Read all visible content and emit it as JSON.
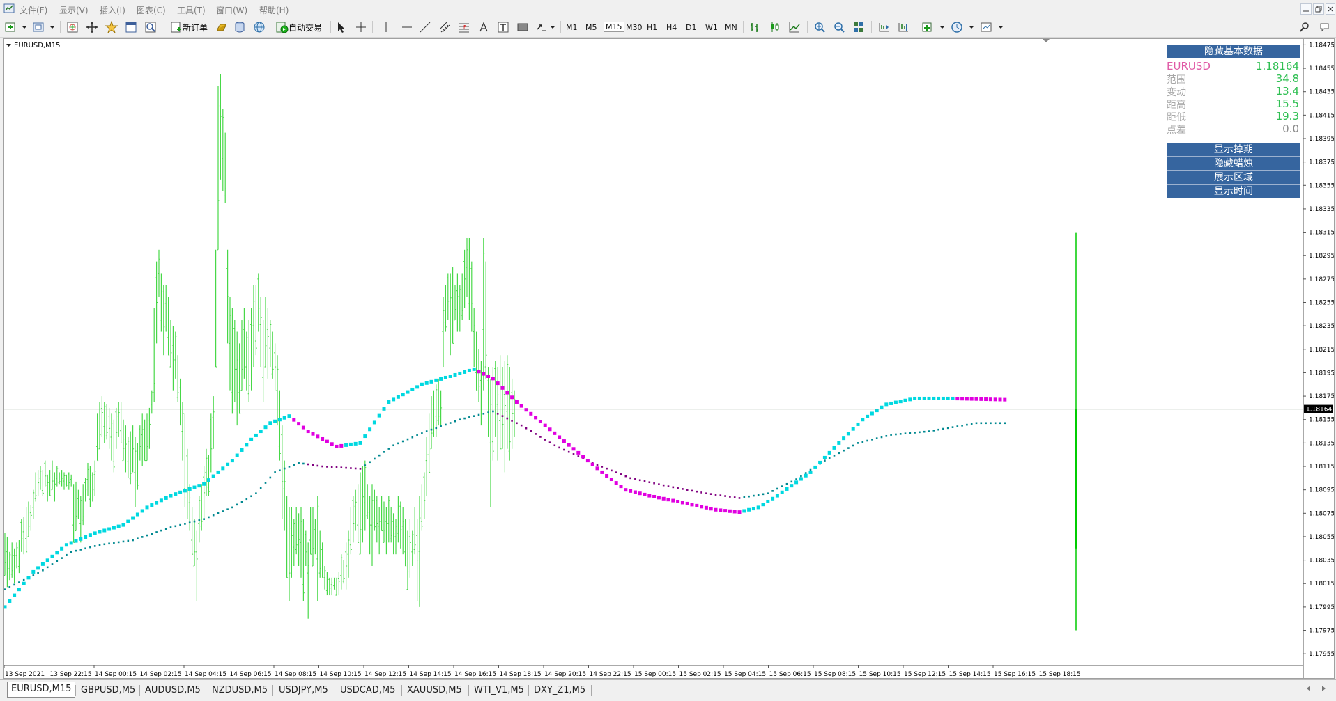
{
  "menu": {
    "items": [
      "文件(F)",
      "显示(V)",
      "插入(I)",
      "图表(C)",
      "工具(T)",
      "窗口(W)",
      "帮助(H)"
    ]
  },
  "toolbar": {
    "new_order_label": "新订单",
    "auto_trade_label": "自动交易",
    "timeframes": [
      "M1",
      "M5",
      "M15",
      "M30",
      "H1",
      "H4",
      "D1",
      "W1",
      "MN"
    ]
  },
  "chart": {
    "title": "EURUSD,M15",
    "current_price_label": "1.18164",
    "colors": {
      "bar": "#48d848",
      "last_bar": "#00cc00",
      "ma_up": "#00d8e0",
      "ma_down": "#e000e0",
      "ma2_up": "#008890",
      "ma2_down": "#800080"
    },
    "y_axis": {
      "min": 1.17945,
      "max": 1.1848
    },
    "y_ticks": [
      "1.18475",
      "1.18455",
      "1.18435",
      "1.18415",
      "1.18395",
      "1.18375",
      "1.18355",
      "1.18335",
      "1.18315",
      "1.18295",
      "1.18275",
      "1.18255",
      "1.18235",
      "1.18215",
      "1.18195",
      "1.18175",
      "1.18155",
      "1.18135",
      "1.18115",
      "1.18095",
      "1.18075",
      "1.18055",
      "1.18035",
      "1.18015",
      "1.17995",
      "1.17975",
      "1.17955"
    ],
    "x_ticks": [
      "13 Sep 2021",
      "13 Sep 22:15",
      "14 Sep 00:15",
      "14 Sep 02:15",
      "14 Sep 04:15",
      "14 Sep 06:15",
      "14 Sep 08:15",
      "14 Sep 10:15",
      "14 Sep 12:15",
      "14 Sep 14:15",
      "14 Sep 16:15",
      "14 Sep 18:15",
      "14 Sep 20:15",
      "14 Sep 22:15",
      "15 Sep 00:15",
      "15 Sep 02:15",
      "15 Sep 04:15",
      "15 Sep 06:15",
      "15 Sep 08:15",
      "15 Sep 10:15",
      "15 Sep 12:15",
      "15 Sep 14:15",
      "15 Sep 16:15",
      "15 Sep 18:15"
    ]
  },
  "info_panel": {
    "hide_basic_data": "隐藏基本数据",
    "symbol": "EURUSD",
    "price": "1.18164",
    "rows": [
      {
        "label": "范围",
        "value": "34.8"
      },
      {
        "label": "变动",
        "value": "13.4"
      },
      {
        "label": "距高",
        "value": "15.5"
      },
      {
        "label": "距低",
        "value": "19.3"
      },
      {
        "label": "点差",
        "value": "0.0"
      }
    ],
    "buttons": [
      "显示掉期",
      "隐藏蜡烛",
      "展示区域",
      "显示时间"
    ]
  },
  "tabs": [
    "EURUSD,M15",
    "GBPUSD,M5",
    "AUDUSD,M5",
    "NZDUSD,M5",
    "USDJPY,M5",
    "USDCAD,M5",
    "XAUUSD,M5",
    "WTI_V1,M5",
    "DXY_Z1,M5"
  ],
  "chart_data": {
    "type": "ohlc",
    "symbol": "EURUSD",
    "timeframe": "M15",
    "current_price": 1.18164,
    "ylim": [
      1.17945,
      1.1848
    ],
    "last_bar": {
      "high": 1.18315,
      "low": 1.17975,
      "open": 1.18164,
      "close": 1.18045
    },
    "ranges": [
      [
        1.18058,
        1.18022
      ],
      [
        1.18055,
        1.18012
      ],
      [
        1.18042,
        1.18018
      ],
      [
        1.1805,
        1.1802
      ],
      [
        1.18045,
        1.18015
      ],
      [
        1.1805,
        1.18028
      ],
      [
        1.18052,
        1.18024
      ],
      [
        1.1807,
        1.18042
      ],
      [
        1.18072,
        1.1804
      ],
      [
        1.1808,
        1.18042
      ],
      [
        1.18085,
        1.18055
      ],
      [
        1.18082,
        1.1806
      ],
      [
        1.18095,
        1.1807
      ],
      [
        1.1811,
        1.18085
      ],
      [
        1.18112,
        1.1809
      ],
      [
        1.18115,
        1.18095
      ],
      [
        1.18112,
        1.1809
      ],
      [
        1.1812,
        1.18098
      ],
      [
        1.18108,
        1.18085
      ],
      [
        1.18112,
        1.1809
      ],
      [
        1.1812,
        1.18095
      ],
      [
        1.1811,
        1.18085
      ],
      [
        1.18115,
        1.18098
      ],
      [
        1.1811,
        1.181
      ],
      [
        1.18112,
        1.18098
      ],
      [
        1.1811,
        1.18095
      ],
      [
        1.18108,
        1.18098
      ],
      [
        1.1811,
        1.18095
      ],
      [
        1.18108,
        1.18098
      ],
      [
        1.181,
        1.1805
      ],
      [
        1.18102,
        1.1806
      ],
      [
        1.18095,
        1.1807
      ],
      [
        1.1809,
        1.1805
      ],
      [
        1.181,
        1.18065
      ],
      [
        1.18105,
        1.18085
      ],
      [
        1.18118,
        1.1809
      ],
      [
        1.18115,
        1.1808
      ],
      [
        1.1811,
        1.18085
      ],
      [
        1.1812,
        1.1809
      ],
      [
        1.1816,
        1.1812
      ],
      [
        1.1817,
        1.1813
      ],
      [
        1.18175,
        1.1814
      ],
      [
        1.1817,
        1.18135
      ],
      [
        1.18168,
        1.18138
      ],
      [
        1.18165,
        1.1813
      ],
      [
        1.1816,
        1.1812
      ],
      [
        1.18155,
        1.1811
      ],
      [
        1.18165,
        1.1813
      ],
      [
        1.1817,
        1.1814
      ],
      [
        1.1817,
        1.18135
      ],
      [
        1.18155,
        1.1812
      ],
      [
        1.1815,
        1.1811
      ],
      [
        1.1814,
        1.18105
      ],
      [
        1.18145,
        1.181
      ],
      [
        1.1815,
        1.1811
      ],
      [
        1.1814,
        1.1808
      ],
      [
        1.18135,
        1.18095
      ],
      [
        1.1815,
        1.1812
      ],
      [
        1.1816,
        1.18115
      ],
      [
        1.18155,
        1.1812
      ],
      [
        1.1816,
        1.1812
      ],
      [
        1.18165,
        1.1813
      ],
      [
        1.1818,
        1.1816
      ],
      [
        1.1825,
        1.1817
      ],
      [
        1.1829,
        1.1822
      ],
      [
        1.183,
        1.1826
      ],
      [
        1.1828,
        1.1823
      ],
      [
        1.1827,
        1.1821
      ],
      [
        1.1827,
        1.1823
      ],
      [
        1.1826,
        1.1821
      ],
      [
        1.1824,
        1.182
      ],
      [
        1.18235,
        1.1818
      ],
      [
        1.1823,
        1.1819
      ],
      [
        1.1821,
        1.1817
      ],
      [
        1.1819,
        1.1815
      ],
      [
        1.1817,
        1.1812
      ],
      [
        1.1816,
        1.1808
      ],
      [
        1.1813,
        1.1807
      ],
      [
        1.181,
        1.1806
      ],
      [
        1.1808,
        1.1804
      ],
      [
        1.1807,
        1.1803
      ],
      [
        1.1806,
        1.18
      ],
      [
        1.1809,
        1.1805
      ],
      [
        1.181,
        1.1806
      ],
      [
        1.18115,
        1.1807
      ],
      [
        1.1813,
        1.1809
      ],
      [
        1.18125,
        1.1809
      ],
      [
        1.1816,
        1.1811
      ],
      [
        1.18175,
        1.1813
      ],
      [
        1.183,
        1.182
      ],
      [
        1.1844,
        1.183
      ],
      [
        1.1845,
        1.1836
      ],
      [
        1.1842,
        1.1835
      ],
      [
        1.184,
        1.1834
      ],
      [
        1.183,
        1.1822
      ],
      [
        1.1826,
        1.1818
      ],
      [
        1.1825,
        1.1816
      ],
      [
        1.1824,
        1.1817
      ],
      [
        1.1823,
        1.1815
      ],
      [
        1.1822,
        1.1816
      ],
      [
        1.1824,
        1.1818
      ],
      [
        1.1825,
        1.1819
      ],
      [
        1.1823,
        1.1818
      ],
      [
        1.1824,
        1.1817
      ],
      [
        1.1825,
        1.1818
      ],
      [
        1.1827,
        1.182
      ],
      [
        1.1827,
        1.1821
      ],
      [
        1.1828,
        1.1823
      ],
      [
        1.1826,
        1.182
      ],
      [
        1.1824,
        1.1817
      ],
      [
        1.1826,
        1.182
      ],
      [
        1.1825,
        1.1819
      ],
      [
        1.1824,
        1.182
      ],
      [
        1.1823,
        1.1819
      ],
      [
        1.1822,
        1.1818
      ],
      [
        1.1821,
        1.1815
      ],
      [
        1.1818,
        1.1812
      ],
      [
        1.1815,
        1.1807
      ],
      [
        1.1812,
        1.1806
      ],
      [
        1.1809,
        1.1802
      ],
      [
        1.1808,
        1.18
      ],
      [
        1.1808,
        1.1802
      ],
      [
        1.1807,
        1.1803
      ],
      [
        1.1808,
        1.1804
      ],
      [
        1.18075,
        1.1803
      ],
      [
        1.1808,
        1.1802
      ],
      [
        1.1807,
        1.18
      ],
      [
        1.1806,
        1.1803
      ],
      [
        1.1805,
        1.17985
      ],
      [
        1.1808,
        1.1804
      ],
      [
        1.1808,
        1.1803
      ],
      [
        1.1807,
        1.1804
      ],
      [
        1.1809,
        1.18
      ],
      [
        1.1806,
        1.1802
      ],
      [
        1.1805,
        1.1802
      ],
      [
        1.1803,
        1.1801
      ],
      [
        1.18025,
        1.18005
      ],
      [
        1.1802,
        1.18005
      ],
      [
        1.1802,
        1.18005
      ],
      [
        1.1802,
        1.1801
      ],
      [
        1.1802,
        1.18005
      ],
      [
        1.18025,
        1.18005
      ],
      [
        1.1804,
        1.1801
      ],
      [
        1.18035,
        1.18015
      ],
      [
        1.1805,
        1.1801
      ],
      [
        1.1806,
        1.1802
      ],
      [
        1.1808,
        1.1804
      ],
      [
        1.1809,
        1.1805
      ],
      [
        1.18095,
        1.1806
      ],
      [
        1.181,
        1.1805
      ],
      [
        1.1811,
        1.1804
      ],
      [
        1.18115,
        1.1805
      ],
      [
        1.1812,
        1.1806
      ],
      [
        1.181,
        1.1807
      ],
      [
        1.1809,
        1.1804
      ],
      [
        1.181,
        1.1803
      ],
      [
        1.18095,
        1.1806
      ],
      [
        1.1809,
        1.1805
      ],
      [
        1.1808,
        1.1804
      ],
      [
        1.1809,
        1.1806
      ],
      [
        1.18085,
        1.1805
      ],
      [
        1.1808,
        1.1804
      ],
      [
        1.1809,
        1.1805
      ],
      [
        1.1808,
        1.1805
      ],
      [
        1.18075,
        1.1804
      ],
      [
        1.1807,
        1.1804
      ],
      [
        1.1809,
        1.1805
      ],
      [
        1.18085,
        1.18045
      ],
      [
        1.1808,
        1.1804
      ],
      [
        1.1807,
        1.1803
      ],
      [
        1.1806,
        1.1801
      ],
      [
        1.1807,
        1.1802
      ],
      [
        1.1806,
        1.1803
      ],
      [
        1.1808,
        1.1804
      ],
      [
        1.1807,
        1.18
      ],
      [
        1.1809,
        1.17995
      ],
      [
        1.181,
        1.1806
      ],
      [
        1.1811,
        1.1807
      ],
      [
        1.1814,
        1.1809
      ],
      [
        1.1816,
        1.1811
      ],
      [
        1.18175,
        1.1813
      ],
      [
        1.1818,
        1.1814
      ],
      [
        1.18185,
        1.1814
      ],
      [
        1.1819,
        1.1815
      ],
      [
        1.1818,
        1.1815
      ],
      [
        1.1826,
        1.182
      ],
      [
        1.1827,
        1.1823
      ],
      [
        1.1828,
        1.1824
      ],
      [
        1.1828,
        1.1821
      ],
      [
        1.18285,
        1.1822
      ],
      [
        1.1827,
        1.1824
      ],
      [
        1.1828,
        1.1823
      ],
      [
        1.1827,
        1.1823
      ],
      [
        1.1828,
        1.1824
      ],
      [
        1.183,
        1.1825
      ],
      [
        1.1831,
        1.1826
      ],
      [
        1.1831,
        1.1824
      ],
      [
        1.1829,
        1.1823
      ],
      [
        1.1825,
        1.182
      ],
      [
        1.1823,
        1.1818
      ],
      [
        1.18215,
        1.1817
      ],
      [
        1.18205,
        1.1815
      ],
      [
        1.1831,
        1.1818
      ],
      [
        1.1829,
        1.1819
      ],
      [
        1.182,
        1.1814
      ],
      [
        1.1819,
        1.1808
      ],
      [
        1.182,
        1.1812
      ],
      [
        1.18205,
        1.1814
      ],
      [
        1.182,
        1.1812
      ],
      [
        1.1821,
        1.1813
      ],
      [
        1.182,
        1.1813
      ],
      [
        1.18205,
        1.1811
      ],
      [
        1.1821,
        1.1813
      ],
      [
        1.182,
        1.1812
      ],
      [
        1.1819,
        1.1813
      ],
      [
        1.1818,
        1.1814
      ]
    ],
    "ma1": [
      [
        0,
        1.17995
      ],
      [
        12,
        1.18025
      ],
      [
        26,
        1.18048
      ],
      [
        38,
        1.18058
      ],
      [
        50,
        1.18065
      ],
      [
        60,
        1.1808
      ],
      [
        70,
        1.1809
      ],
      [
        84,
        1.181
      ],
      [
        96,
        1.1812
      ],
      [
        104,
        1.18138
      ],
      [
        112,
        1.18152
      ],
      [
        120,
        1.18158
      ],
      [
        128,
        1.18145
      ],
      [
        140,
        1.18132
      ],
      [
        150,
        1.18135
      ],
      [
        162,
        1.1817
      ],
      [
        176,
        1.18185
      ],
      [
        188,
        1.18192
      ],
      [
        198,
        1.18198
      ],
      [
        206,
        1.1819
      ],
      [
        216,
        1.1817
      ],
      [
        228,
        1.1815
      ],
      [
        240,
        1.1813
      ],
      [
        252,
        1.1811
      ],
      [
        262,
        1.18095
      ],
      [
        272,
        1.1809
      ],
      [
        284,
        1.18085
      ],
      [
        300,
        1.18078
      ],
      [
        310,
        1.18076
      ],
      [
        318,
        1.1808
      ],
      [
        326,
        1.1809
      ],
      [
        340,
        1.1811
      ],
      [
        352,
        1.18135
      ],
      [
        362,
        1.18155
      ],
      [
        372,
        1.18168
      ],
      [
        384,
        1.18173
      ],
      [
        400,
        1.18173
      ],
      [
        422,
        1.18172
      ]
    ],
    "ma2": [
      [
        0,
        1.1801
      ],
      [
        15,
        1.18025
      ],
      [
        28,
        1.18042
      ],
      [
        40,
        1.18048
      ],
      [
        54,
        1.18052
      ],
      [
        70,
        1.18063
      ],
      [
        84,
        1.1807
      ],
      [
        96,
        1.1808
      ],
      [
        106,
        1.18092
      ],
      [
        114,
        1.1811
      ],
      [
        124,
        1.18118
      ],
      [
        134,
        1.18115
      ],
      [
        150,
        1.18113
      ],
      [
        164,
        1.18133
      ],
      [
        178,
        1.18145
      ],
      [
        192,
        1.18155
      ],
      [
        206,
        1.18162
      ],
      [
        218,
        1.1815
      ],
      [
        232,
        1.18133
      ],
      [
        248,
        1.18118
      ],
      [
        264,
        1.18105
      ],
      [
        280,
        1.18098
      ],
      [
        296,
        1.18092
      ],
      [
        310,
        1.18088
      ],
      [
        322,
        1.18092
      ],
      [
        334,
        1.18104
      ],
      [
        346,
        1.1812
      ],
      [
        360,
        1.18135
      ],
      [
        374,
        1.18142
      ],
      [
        390,
        1.18145
      ],
      [
        410,
        1.18152
      ],
      [
        422,
        1.18152
      ]
    ]
  }
}
